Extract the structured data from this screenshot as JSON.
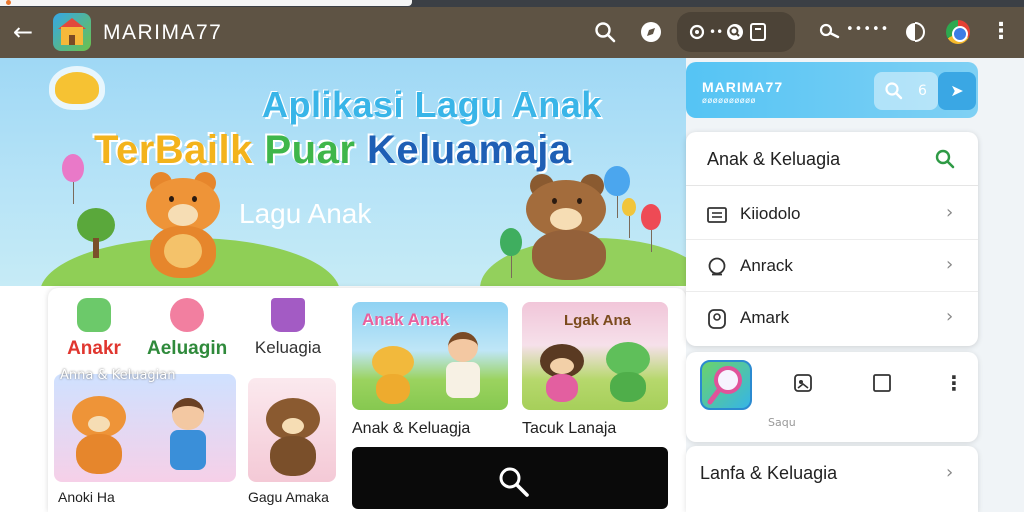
{
  "app_bar": {
    "title": "MARIMA77",
    "pill_dots": "••",
    "key_dots": "•••••"
  },
  "hero": {
    "heading_line1": "Aplikasi Lagu Anak",
    "heading_line2_part1": "TerBailk ",
    "heading_line2_part2": "Puar ",
    "heading_line2_part3": "Keluamaja",
    "subtitle": "Lagu Anak"
  },
  "categories": [
    {
      "label": "Anakr",
      "color": "#e0362f",
      "icon_color": "#6cc96a"
    },
    {
      "label": "Aeluagin",
      "color": "#2f8a3b",
      "icon_color": "#f27fa0"
    },
    {
      "label": "Keluagia",
      "color": "#333333",
      "icon_color": "#a35bc4"
    }
  ],
  "small_caption": "Anna & Keluagian",
  "tiles": {
    "tile1_caption": "Anoki Ha",
    "tile2_caption": "Gagu Amaka",
    "tile3_overlay": "Anak Anak",
    "tile3_caption": "Anak & Keluagja",
    "tile4_overlay": "Lgak Ana",
    "tile4_caption": "Tacuk Lanaja"
  },
  "side_panel": {
    "brand": "MARIMA77",
    "brand_sub": "øøøøøøøøøø",
    "seg_label": "6",
    "menu_title": "Anak & Keluagia",
    "menu_items": [
      {
        "label": "Kiiodolo",
        "icon": "list-icon"
      },
      {
        "label": "Anrack",
        "icon": "chat-bubble-icon"
      },
      {
        "label": "Amark",
        "icon": "profile-icon"
      }
    ],
    "chevron": "›",
    "app_card_caption": "Saqu",
    "bottom_title": "Lanfa & Keluagia"
  },
  "colors": {
    "app_bar": "#5e5344",
    "accent_blue": "#39b5e8",
    "search_green": "#2e9a45"
  }
}
